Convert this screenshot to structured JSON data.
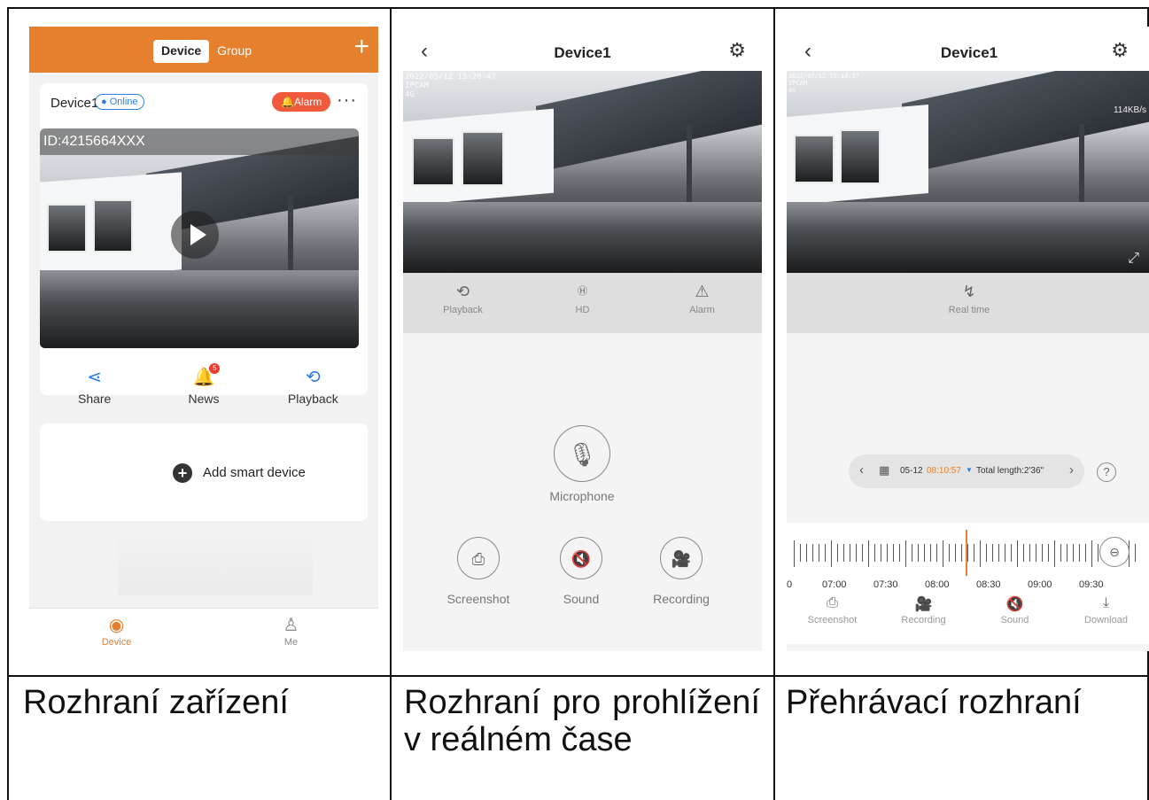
{
  "panel1": {
    "segments": [
      "Device",
      "Group"
    ],
    "add_icon": "plus-icon",
    "device_name": "Device1",
    "status": "Online",
    "alarm": "Alarm",
    "more": "···",
    "device_id": "ID:4215664XXX",
    "actions": [
      {
        "label": "Share",
        "icon": "share-icon"
      },
      {
        "label": "News",
        "icon": "bell-icon",
        "badge": "5"
      },
      {
        "label": "Playback",
        "icon": "playback-icon"
      }
    ],
    "add_device": "Add smart device",
    "tabs": [
      {
        "label": "Device",
        "icon": "camera-icon",
        "active": true
      },
      {
        "label": "Me",
        "icon": "person-icon",
        "active": false
      }
    ],
    "accent": "#e5812e"
  },
  "panel2": {
    "title": "Device1",
    "osd": [
      "2022/05/12 15:20:47",
      "IPCAM",
      "4G"
    ],
    "controls": [
      {
        "label": "Playback",
        "icon": "history-icon"
      },
      {
        "label": "HD",
        "icon": "hd-icon"
      },
      {
        "label": "Alarm",
        "icon": "siren-icon"
      }
    ],
    "microphone": "Microphone",
    "tools": [
      {
        "label": "Screenshot",
        "icon": "camera-icon"
      },
      {
        "label": "Sound",
        "icon": "speaker-mute-icon"
      },
      {
        "label": "Recording",
        "icon": "video-icon"
      }
    ]
  },
  "panel3": {
    "title": "Device1",
    "osd": [
      "2022/05/12 15:10:57",
      "IPCAM",
      "4G"
    ],
    "speed": "114KB/s",
    "realtime": "Real time",
    "date": "05-12",
    "time": "08:10:57",
    "total": "Total length:2'36\"",
    "timeline_labels": [
      "0",
      "07:00",
      "07:30",
      "08:00",
      "08:30",
      "09:00",
      "09:30"
    ],
    "tools": [
      {
        "label": "Screenshot",
        "icon": "camera-icon"
      },
      {
        "label": "Recording",
        "icon": "video-icon"
      },
      {
        "label": "Sound",
        "icon": "speaker-mute-icon"
      },
      {
        "label": "Download",
        "icon": "download-icon"
      }
    ]
  },
  "captions": {
    "c1": "Rozhraní zařízení",
    "c2": "Rozhraní pro prohlížení v reálném čase",
    "c3": "Přehrávací rozhraní"
  }
}
